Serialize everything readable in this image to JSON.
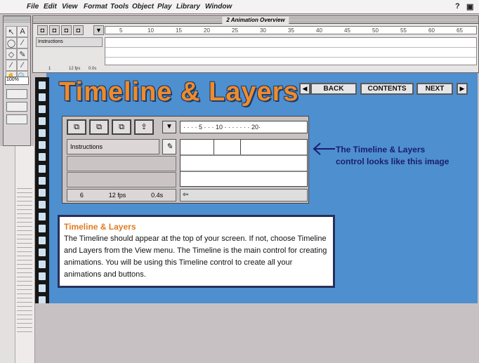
{
  "menubar": {
    "apple": "",
    "items": [
      "File",
      "Edit",
      "View",
      "Format",
      "Tools",
      "Object",
      "Play",
      "Library",
      "Window"
    ],
    "right_icons": [
      "?",
      "▣"
    ]
  },
  "tools": {
    "zoom": "100%",
    "glyphs": [
      "↖",
      "A",
      "◯",
      "∕",
      "◇",
      "✎",
      "∕",
      "∕",
      "✋",
      "🔍"
    ]
  },
  "timeline_window": {
    "title": "2 Animation Overview",
    "layer_name": "Instructions",
    "ruler_marks": [
      "5",
      "10",
      "15",
      "20",
      "25",
      "30",
      "35",
      "40",
      "45",
      "50",
      "55",
      "60",
      "65"
    ],
    "status": {
      "frame": "1",
      "fps": "12 fps",
      "time": "0.0s"
    }
  },
  "content": {
    "heading": "Timeline & Layers",
    "nav": {
      "back": "BACK",
      "contents": "CONTENTS",
      "next": "NEXT"
    },
    "sample": {
      "layer_name": "Instructions",
      "ruler": "· · · · 5 · · · 10 · · · · · · · 20·",
      "frame": "6",
      "fps": "12 fps",
      "time": "0.4s"
    },
    "callout": "The Timeline & Layers control looks like this image",
    "info": {
      "title": "Timeline & Layers",
      "body": "The Timeline should appear at the top of your screen.  If not, choose Timeline and Layers from the View menu. The Timeline is the main control for creating animations. You will be using this Timeline control to create all your animations and buttons."
    }
  },
  "colors": {
    "content_bg": "#4e8fd0",
    "heading": "#f08a2a",
    "callout_text": "#1a1e6a",
    "info_title": "#e07b22"
  }
}
